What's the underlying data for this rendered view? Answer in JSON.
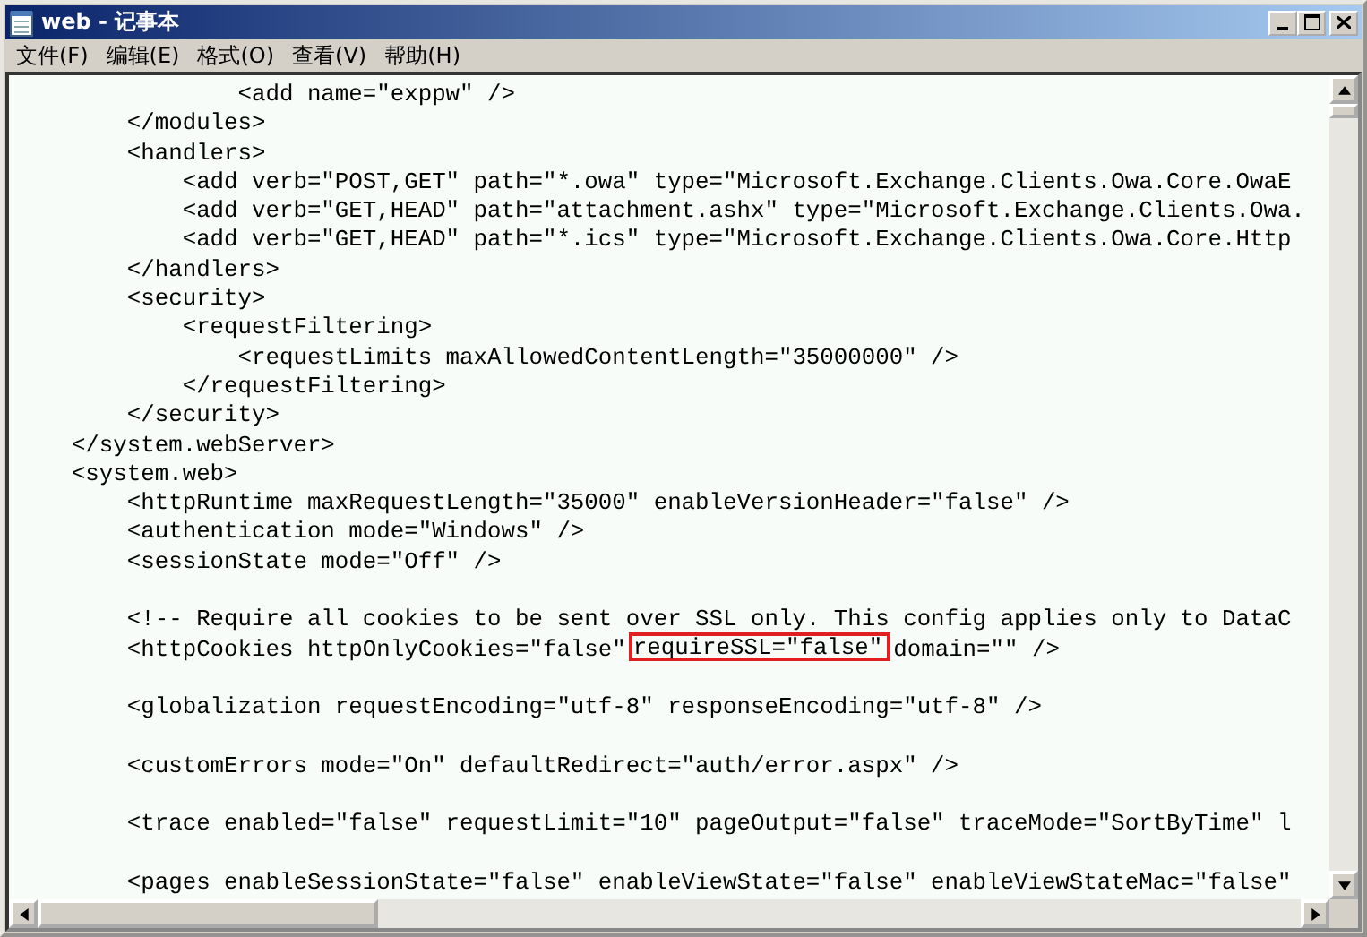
{
  "window": {
    "title": "web - 记事本"
  },
  "menu": [
    "文件(F)",
    "编辑(E)",
    "格式(O)",
    "查看(V)",
    "帮助(H)"
  ],
  "lines": [
    {
      "kind": "code",
      "text": "                <add name=\"exppw\" />"
    },
    {
      "kind": "code",
      "text": "        </modules>"
    },
    {
      "kind": "code",
      "text": "        <handlers>"
    },
    {
      "kind": "code",
      "text": "            <add verb=\"POST,GET\" path=\"*.owa\" type=\"Microsoft.Exchange.Clients.Owa.Core.OwaE"
    },
    {
      "kind": "code",
      "text": "            <add verb=\"GET,HEAD\" path=\"attachment.ashx\" type=\"Microsoft.Exchange.Clients.Owa."
    },
    {
      "kind": "code",
      "text": "            <add verb=\"GET,HEAD\" path=\"*.ics\" type=\"Microsoft.Exchange.Clients.Owa.Core.Http"
    },
    {
      "kind": "code",
      "text": "        </handlers>"
    },
    {
      "kind": "code",
      "text": "        <security>"
    },
    {
      "kind": "code",
      "text": "            <requestFiltering>"
    },
    {
      "kind": "code",
      "text": "                <requestLimits maxAllowedContentLength=\"35000000\" />"
    },
    {
      "kind": "code",
      "text": "            </requestFiltering>"
    },
    {
      "kind": "code",
      "text": "        </security>"
    },
    {
      "kind": "code",
      "text": "    </system.webServer>"
    },
    {
      "kind": "code",
      "text": "    <system.web>"
    },
    {
      "kind": "code",
      "text": "        <httpRuntime maxRequestLength=\"35000\" enableVersionHeader=\"false\" />"
    },
    {
      "kind": "code",
      "text": "        <authentication mode=\"Windows\" />"
    },
    {
      "kind": "code",
      "text": "        <sessionState mode=\"Off\" />"
    },
    {
      "kind": "blank"
    },
    {
      "kind": "code",
      "text": "        <!-- Require all cookies to be sent over SSL only. This config applies only to DataC"
    },
    {
      "kind": "marked",
      "before": "        <httpCookies httpOnlyCookies=\"false\"",
      "marked": "requireSSL=\"false\"",
      "after": "domain=\"\" />"
    },
    {
      "kind": "blank"
    },
    {
      "kind": "code",
      "text": "        <globalization requestEncoding=\"utf-8\" responseEncoding=\"utf-8\" />"
    },
    {
      "kind": "blank"
    },
    {
      "kind": "code",
      "text": "        <customErrors mode=\"On\" defaultRedirect=\"auth/error.aspx\" />"
    },
    {
      "kind": "blank"
    },
    {
      "kind": "code",
      "text": "        <trace enabled=\"false\" requestLimit=\"10\" pageOutput=\"false\" traceMode=\"SortByTime\" l"
    },
    {
      "kind": "blank"
    },
    {
      "kind": "code",
      "text": "        <pages enableSessionState=\"false\" enableViewState=\"false\" enableViewStateMac=\"false\""
    }
  ]
}
